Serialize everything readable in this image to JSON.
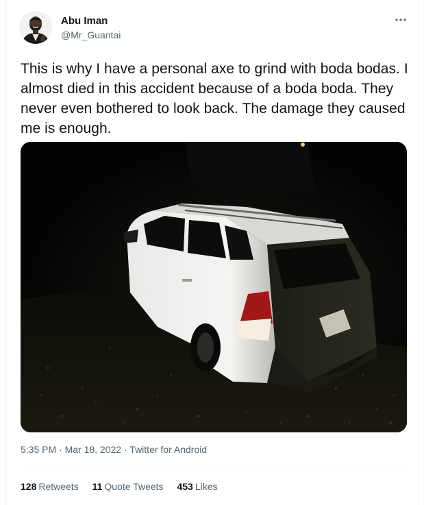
{
  "user": {
    "display_name": "Abu Iman",
    "handle": "@Mr_Guantai",
    "avatar_icon": "profile-photo"
  },
  "tweet": {
    "text": "This is why I have a personal axe to grind with boda bodas. I almost died in this accident because of a boda boda. They never even bothered to look back. The damage they caused me is enough.",
    "more_icon": "ellipsis-icon"
  },
  "media": {
    "subject": "white-suv-in-grass-at-night"
  },
  "meta": {
    "time": "5:35 PM",
    "separator": "·",
    "date": "Mar 18, 2022",
    "source": "Twitter for Android"
  },
  "stats": {
    "retweets_count": "128",
    "retweets_label": "Retweets",
    "quotes_count": "11",
    "quotes_label": "Quote Tweets",
    "likes_count": "453",
    "likes_label": "Likes"
  },
  "colors": {
    "text_primary": "#0f1419",
    "text_secondary": "#536471",
    "divider": "#eff3f4"
  }
}
